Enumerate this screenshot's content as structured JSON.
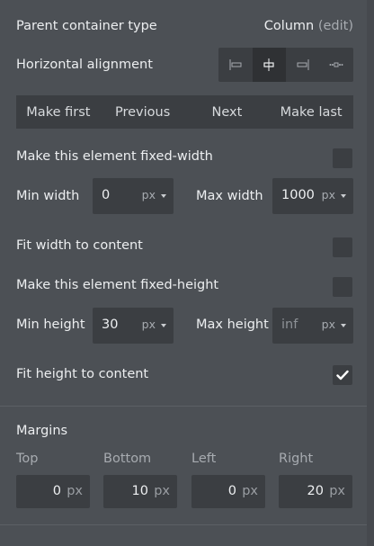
{
  "parent_container": {
    "label": "Parent container type",
    "value": "Column",
    "edit_link": "(edit)"
  },
  "horizontal_alignment": {
    "label": "Horizontal alignment",
    "options": [
      {
        "icon": "align-left-icon",
        "active": false
      },
      {
        "icon": "align-center-icon",
        "active": true
      },
      {
        "icon": "align-right-icon",
        "active": false
      },
      {
        "icon": "align-distribute-icon",
        "active": false
      }
    ]
  },
  "order_buttons": {
    "make_first": "Make first",
    "previous": "Previous",
    "next": "Next",
    "make_last": "Make last"
  },
  "fixed_width": {
    "label": "Make this element fixed-width",
    "checked": false
  },
  "min_width": {
    "label": "Min width",
    "value": "0",
    "unit": "px"
  },
  "max_width": {
    "label": "Max width",
    "value": "1000",
    "unit": "px"
  },
  "fit_width": {
    "label": "Fit width to content",
    "checked": false
  },
  "fixed_height": {
    "label": "Make this element fixed-height",
    "checked": false
  },
  "min_height": {
    "label": "Min height",
    "value": "30",
    "unit": "px"
  },
  "max_height": {
    "label": "Max height",
    "placeholder": "inf",
    "unit": "px"
  },
  "fit_height": {
    "label": "Fit height to content",
    "checked": true
  },
  "margins": {
    "title": "Margins",
    "top": {
      "label": "Top",
      "value": "0",
      "unit": "px"
    },
    "bottom": {
      "label": "Bottom",
      "value": "10",
      "unit": "px"
    },
    "left": {
      "label": "Left",
      "value": "0",
      "unit": "px"
    },
    "right": {
      "label": "Right",
      "value": "20",
      "unit": "px"
    }
  },
  "colors": {
    "panel_bg": "#4c5055",
    "control_bg": "#3b3e42",
    "active_bg": "#2f3134"
  }
}
